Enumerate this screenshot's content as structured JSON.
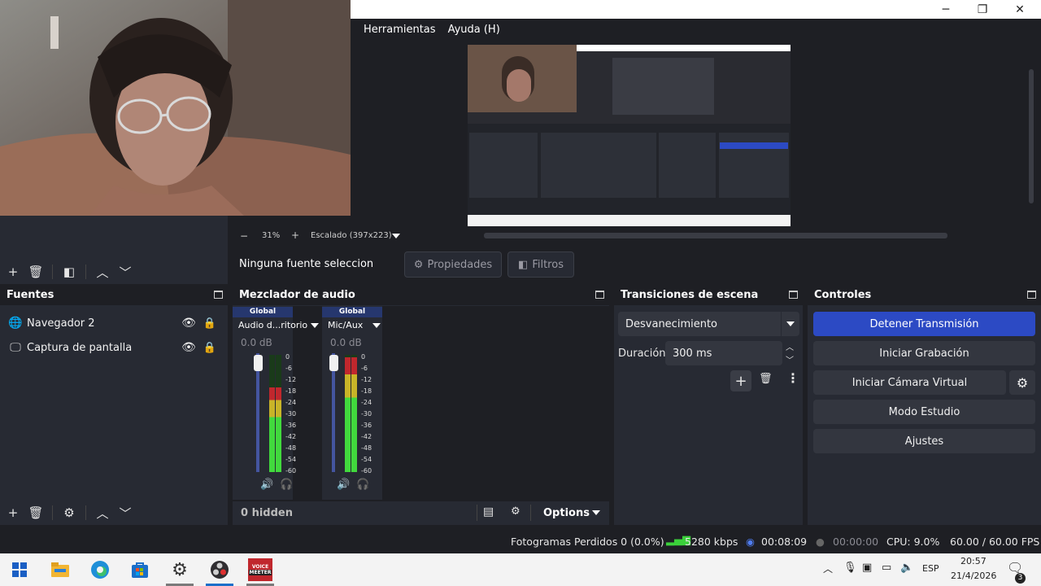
{
  "window": {
    "minimize_glyph": "─",
    "restore_glyph": "❐",
    "close_glyph": "✕"
  },
  "menubar": {
    "items": [
      "Herramientas",
      "Ayuda (H)"
    ]
  },
  "preview": {
    "zoom": "31%",
    "scaling": "Escalado (397x223)"
  },
  "context_bar": {
    "selection_label": "Ninguna fuente seleccionada",
    "properties_label": "Propiedades",
    "filters_label": "Filtros"
  },
  "sources": {
    "title": "Fuentes",
    "items": [
      {
        "name": "Navegador 2",
        "icon": "globe-icon"
      },
      {
        "name": "Captura de pantalla",
        "icon": "monitor-icon"
      }
    ]
  },
  "mixer": {
    "title": "Mezclador de audio",
    "channels": [
      {
        "header": "Global",
        "name": "Audio d...ritorio",
        "db": "0.0 dB",
        "level": 0.72
      },
      {
        "header": "Global",
        "name": "Mic/Aux",
        "db": "0.0 dB",
        "level": 0.98
      }
    ],
    "ticks": [
      "0",
      "-6",
      "-12",
      "-18",
      "-24",
      "-30",
      "-36",
      "-42",
      "-48",
      "-54",
      "-60"
    ],
    "hidden_label": "0 hidden",
    "options_label": "Options"
  },
  "transitions": {
    "title": "Transiciones de escena",
    "selected": "Desvanecimiento",
    "duration_label": "Duración",
    "duration_value": "300 ms"
  },
  "controls": {
    "title": "Controles",
    "stop_stream": "Detener Transmisión",
    "start_recording": "Iniciar Grabación",
    "start_virtual_cam": "Iniciar Cámara Virtual",
    "studio_mode": "Modo Estudio",
    "settings": "Ajustes"
  },
  "status": {
    "dropped_frames": "Fotogramas Perdidos 0 (0.0%)",
    "bitrate": "5280 kbps",
    "stream_time": "00:08:09",
    "record_time": "00:00:00",
    "cpu": "CPU: 9.0%",
    "fps": "60.00 / 60.00 FPS"
  },
  "taskbar": {
    "language": "ESP",
    "time": "20:57",
    "date": "21/4/2026",
    "notification_count": "3",
    "voicemeeter_top": "VOICE",
    "voicemeeter_bottom": "MEETER"
  },
  "colors": {
    "accent_blue": "#2c4ac4",
    "dock_bg": "#272a33",
    "app_bg": "#1e1f24",
    "meter_green": "#41d93d",
    "meter_yellow": "#c8b428",
    "meter_red": "#c0272d"
  }
}
